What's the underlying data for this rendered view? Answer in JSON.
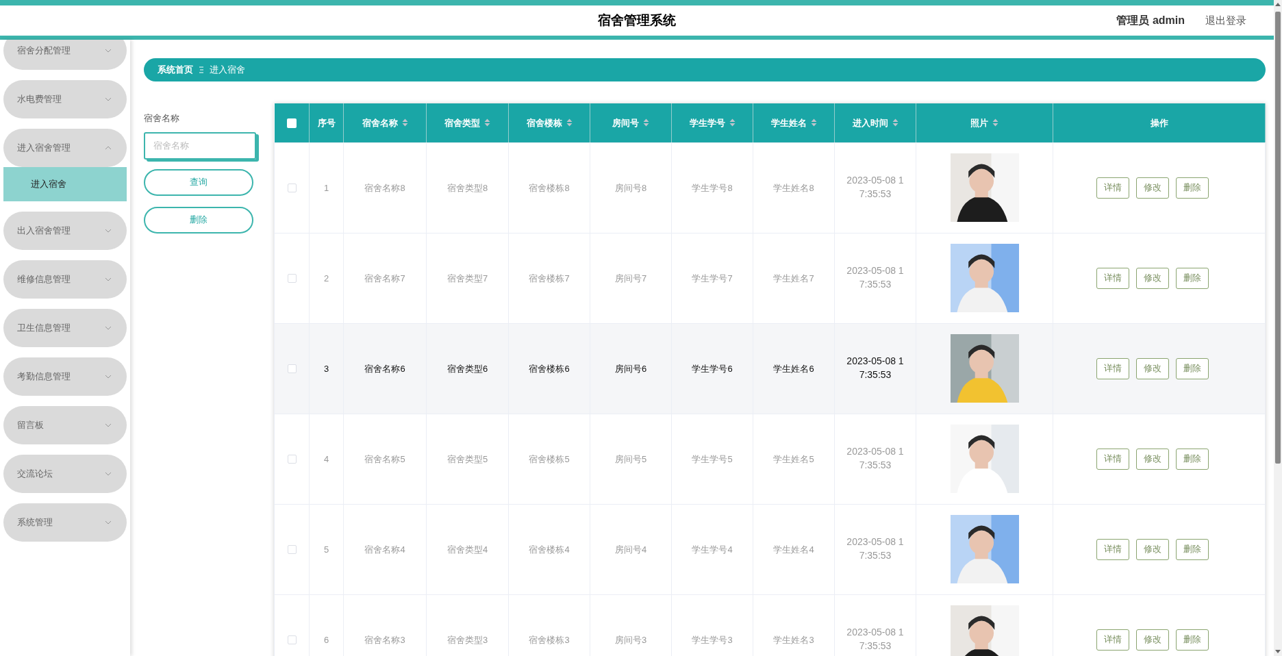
{
  "header": {
    "title": "宿舍管理系统",
    "user": "管理员 admin",
    "logout": "退出登录"
  },
  "sidebar": {
    "items": [
      {
        "label": "宿舍分配管理",
        "expanded": false
      },
      {
        "label": "水电费管理",
        "expanded": false
      },
      {
        "label": "进入宿舍管理",
        "expanded": true,
        "children": [
          {
            "label": "进入宿舍",
            "selected": true
          }
        ]
      },
      {
        "label": "出入宿舍管理",
        "expanded": false
      },
      {
        "label": "维修信息管理",
        "expanded": false
      },
      {
        "label": "卫生信息管理",
        "expanded": false
      },
      {
        "label": "考勤信息管理",
        "expanded": false
      },
      {
        "label": "留言板",
        "expanded": false
      },
      {
        "label": "交流论坛",
        "expanded": false
      },
      {
        "label": "系统管理",
        "expanded": false
      }
    ]
  },
  "breadcrumb": [
    "系统首页",
    "进入宿舍"
  ],
  "search": {
    "label": "宿舍名称",
    "placeholder": "宿舍名称"
  },
  "buttons": [
    "查询",
    "删除"
  ],
  "table": {
    "select_all": {
      "checked": false
    },
    "columns": [
      {
        "label": "序号",
        "sortable": false
      },
      {
        "label": "宿舍名称",
        "sortable": true
      },
      {
        "label": "宿舍类型",
        "sortable": true
      },
      {
        "label": "宿舍楼栋",
        "sortable": true
      },
      {
        "label": "房间号",
        "sortable": true
      },
      {
        "label": "学生学号",
        "sortable": true
      },
      {
        "label": "学生姓名",
        "sortable": true
      },
      {
        "label": "进入时间",
        "sortable": true
      },
      {
        "label": "照片",
        "sortable": true
      },
      {
        "label": "操作",
        "sortable": false
      }
    ],
    "rows": [
      {
        "checked": false,
        "hovered": false,
        "cells": [
          "1",
          "宿舍名称8",
          "宿舍类型8",
          "宿舍楼栋8",
          "房间号8",
          "学生学号8",
          "学生姓名8",
          "2023-05-08 17:35:53"
        ],
        "actions": [
          "详情",
          "修改",
          "删除"
        ]
      },
      {
        "checked": false,
        "hovered": false,
        "cells": [
          "2",
          "宿舍名称7",
          "宿舍类型7",
          "宿舍楼栋7",
          "房间号7",
          "学生学号7",
          "学生姓名7",
          "2023-05-08 17:35:53"
        ],
        "actions": [
          "详情",
          "修改",
          "删除"
        ]
      },
      {
        "checked": false,
        "hovered": true,
        "cells": [
          "3",
          "宿舍名称6",
          "宿舍类型6",
          "宿舍楼栋6",
          "房间号6",
          "学生学号6",
          "学生姓名6",
          "2023-05-08 17:35:53"
        ],
        "actions": [
          "详情",
          "修改",
          "删除"
        ]
      },
      {
        "checked": false,
        "hovered": false,
        "cells": [
          "4",
          "宿舍名称5",
          "宿舍类型5",
          "宿舍楼栋5",
          "房间号5",
          "学生学号5",
          "学生姓名5",
          "2023-05-08 17:35:53"
        ],
        "actions": [
          "详情",
          "修改",
          "删除"
        ]
      },
      {
        "checked": false,
        "hovered": false,
        "cells": [
          "5",
          "宿舍名称4",
          "宿舍类型4",
          "宿舍楼栋4",
          "房间号4",
          "学生学号4",
          "学生姓名4",
          "2023-05-08 17:35:53"
        ],
        "actions": [
          "详情",
          "修改",
          "删除"
        ]
      },
      {
        "checked": false,
        "hovered": false,
        "cells": [
          "6",
          "宿舍名称3",
          "宿舍类型3",
          "宿舍楼栋3",
          "房间号3",
          "学生学号3",
          "学生姓名3",
          "2023-05-08 17:35:53"
        ],
        "actions": [
          "详情",
          "修改",
          "删除"
        ]
      }
    ]
  }
}
